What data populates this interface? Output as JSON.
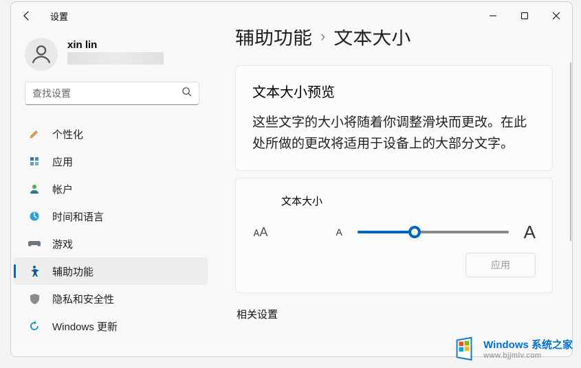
{
  "app_title": "设置",
  "user": {
    "name": "xin lin"
  },
  "search": {
    "placeholder": "查找设置"
  },
  "sidebar": {
    "items": [
      {
        "label": "个性化"
      },
      {
        "label": "应用"
      },
      {
        "label": "帐户"
      },
      {
        "label": "时间和语言"
      },
      {
        "label": "游戏"
      },
      {
        "label": "辅助功能"
      },
      {
        "label": "隐私和安全性"
      },
      {
        "label": "Windows 更新"
      }
    ]
  },
  "breadcrumb": {
    "parent": "辅助功能",
    "current": "文本大小"
  },
  "preview": {
    "title": "文本大小预览",
    "body": "这些文字的大小将随着你调整滑块而更改。在此处所做的更改将适用于设备上的大部分文字。"
  },
  "slider": {
    "label": "文本大小",
    "icon": "ᴀA",
    "min_label": "A",
    "max_label": "A",
    "apply": "应用"
  },
  "related": {
    "title": "相关设置"
  },
  "watermark": {
    "title": "Windows 系统之家",
    "url": "www.bjjmlv.com"
  }
}
